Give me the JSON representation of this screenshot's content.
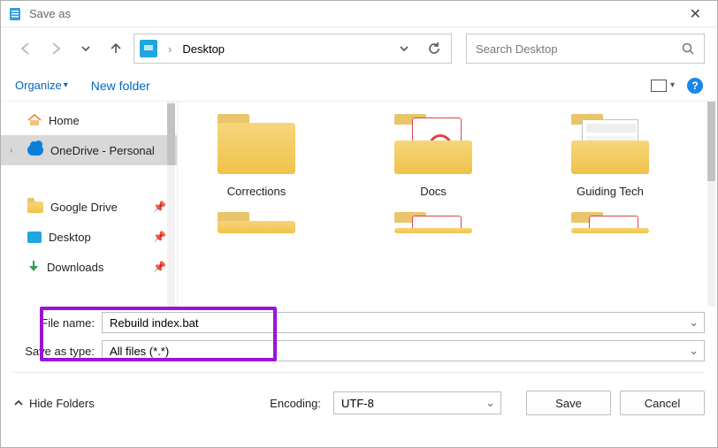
{
  "window": {
    "title": "Save as"
  },
  "nav": {
    "location": "Desktop",
    "search_placeholder": "Search Desktop"
  },
  "toolbar": {
    "organize": "Organize",
    "new_folder": "New folder"
  },
  "sidebar": {
    "items": [
      {
        "label": "Home",
        "icon": "home-icon"
      },
      {
        "label": "OneDrive - Personal",
        "icon": "cloud-icon",
        "selected": true,
        "expandable": true
      },
      {
        "label": "Google Drive",
        "icon": "folder-icon",
        "pinned": true
      },
      {
        "label": "Desktop",
        "icon": "desktop-icon",
        "pinned": true
      },
      {
        "label": "Downloads",
        "icon": "download-icon",
        "pinned": true
      }
    ]
  },
  "pane": {
    "folders": [
      {
        "label": "Corrections",
        "variant": "plain"
      },
      {
        "label": "Docs",
        "variant": "doc"
      },
      {
        "label": "Guiding Tech",
        "variant": "window"
      }
    ],
    "row2": [
      {
        "variant": "plain"
      },
      {
        "variant": "doc"
      },
      {
        "variant": "doc"
      }
    ]
  },
  "form": {
    "file_name_label": "File name:",
    "file_name_value": "Rebuild index.bat",
    "type_label": "Save as type:",
    "type_value": "All files  (*.*)"
  },
  "footer": {
    "hide_folders": "Hide Folders",
    "encoding_label": "Encoding:",
    "encoding_value": "UTF-8",
    "save": "Save",
    "cancel": "Cancel"
  }
}
